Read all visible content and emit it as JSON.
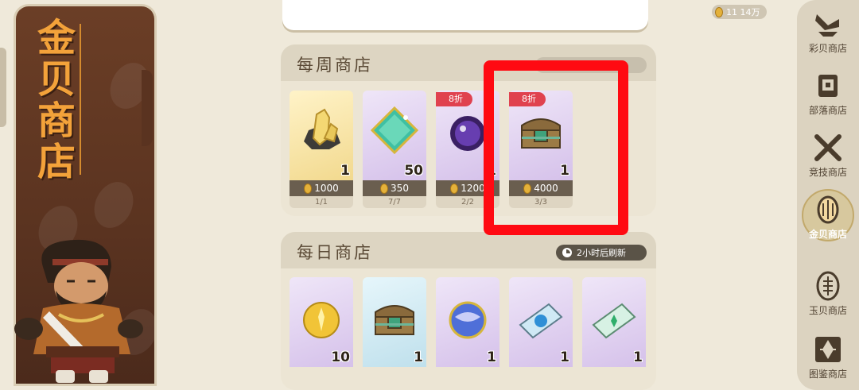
{
  "shop_title_chars": [
    "金",
    "贝",
    "商",
    "店"
  ],
  "currency": {
    "amount": "11  14万",
    "icon": "gold-shell-icon"
  },
  "weekly_shop": {
    "title": "每周商店",
    "items": [
      {
        "icon": "crystal-ore-icon",
        "bg": "yellow",
        "qty": "1",
        "price": "1000",
        "stock": "1/1",
        "discount": ""
      },
      {
        "icon": "green-diamond-icon",
        "bg": "purple",
        "qty": "50",
        "price": "350",
        "stock": "7/7",
        "discount": ""
      },
      {
        "icon": "purple-orb-icon",
        "bg": "purple",
        "qty": "1",
        "price": "1200",
        "stock": "2/2",
        "discount": "8折"
      },
      {
        "icon": "treasure-chest-icon",
        "bg": "purple",
        "qty": "1",
        "price": "4000",
        "stock": "3/3",
        "discount": "8折"
      }
    ]
  },
  "daily_shop": {
    "title": "每日商店",
    "refresh_text": "2小时后刷新",
    "items": [
      {
        "icon": "gold-orb-icon",
        "bg": "purple",
        "qty": "10"
      },
      {
        "icon": "treasure-chest-icon",
        "bg": "blue",
        "qty": "1"
      },
      {
        "icon": "blue-orb-icon",
        "bg": "purple",
        "qty": "1"
      },
      {
        "icon": "blue-ticket-icon",
        "bg": "purple",
        "qty": "1"
      },
      {
        "icon": "green-ticket-icon",
        "bg": "purple",
        "qty": "1"
      }
    ]
  },
  "nav": [
    {
      "label": "彩贝商店",
      "icon": "colorful-shell-icon",
      "active": false
    },
    {
      "label": "部落商店",
      "icon": "tribe-totem-icon",
      "active": false
    },
    {
      "label": "竞技商店",
      "icon": "crossed-weapons-icon",
      "active": false
    },
    {
      "label": "金贝商店",
      "icon": "gold-shell-icon",
      "active": true
    },
    {
      "label": "玉贝商店",
      "icon": "jade-shell-icon",
      "active": false
    },
    {
      "label": "图鉴商店",
      "icon": "encyclopedia-icon",
      "active": false
    }
  ],
  "colors": {
    "banner_brown": "#5a3320",
    "title_orange": "#f3a23a",
    "discount_red": "#e0424f",
    "highlight_red": "#ff0a12",
    "price_bar": "#6a5e4f"
  }
}
